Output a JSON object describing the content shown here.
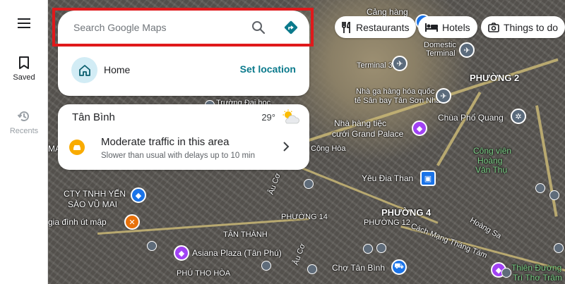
{
  "rail": {
    "saved_label": "Saved",
    "recents_label": "Recents"
  },
  "search": {
    "placeholder": "Search Google Maps"
  },
  "home": {
    "label": "Home",
    "action": "Set location"
  },
  "area": {
    "name": "Tân Bình",
    "temperature": "29°",
    "traffic_title": "Moderate traffic in this area",
    "traffic_subtitle": "Slower than usual with delays up to 10 min"
  },
  "chips": [
    {
      "label": "Restaurants"
    },
    {
      "label": "Hotels"
    },
    {
      "label": "Things to do"
    }
  ],
  "map_labels": {
    "cang_hang": "Cảng hàng",
    "domestic_terminal_1": "Domestic",
    "domestic_terminal_2": "Terminal",
    "terminal3": "Terminal 3",
    "phuong2": "PHƯỜNG 2",
    "nha_ga_1": "Nhà ga hàng hóa quốc",
    "nha_ga_2": "tế Sân bay Tân Sơn Nhất",
    "truong_dai_hoc": "Trường Đại học",
    "chua_pho_quang": "Chùa Phổ Quang",
    "nha_hang_1": "Nhà hàng tiệc",
    "nha_hang_2": "cưới Grand Palace",
    "cong_vien_1": "Công viên",
    "cong_vien_2": "Hoàng",
    "cong_vien_3": "Văn Thụ",
    "cong_hoa": "Cộng Hòa",
    "yeu_dia_than": "Yêu Đia Than",
    "cty_1": "CTY TNHH YẾN",
    "cty_2": "SÀO VŨ MAI",
    "gia_dinh": "gia đình út mập",
    "phuong14": "PHƯỜNG 14",
    "phuong4": "PHƯỜNG 4",
    "phuong12": "PHƯỜNG 12",
    "tan_thanh": "TÂN THÀNH",
    "asiana": "Asiana Plaza (Tân Phú)",
    "phu_tho_hoa": "PHÚ THỌ HÒA",
    "cho_tan_binh": "Chợ Tân Bình",
    "cach_mang": "Cách Mạng Tháng Tám",
    "hoang_sa": "Hoàng Sa",
    "au_co_1": "Âu Cơ",
    "au_co_2": "Âu Cơ",
    "thien_duong_1": "Thiên Đường",
    "thien_duong_2": "Trí Thơ Trâm",
    "ma": "MA"
  },
  "colors": {
    "highlight": "#e0191b",
    "accent": "#0b7a8c",
    "traffic": "#f9ab00"
  }
}
